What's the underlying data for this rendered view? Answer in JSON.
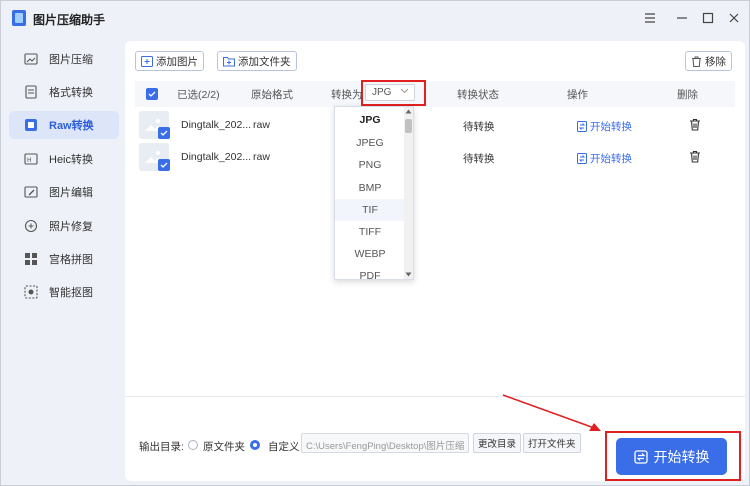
{
  "app": {
    "title": "图片压缩助手"
  },
  "window_controls": {
    "menu": "≡",
    "minimize": "—",
    "maximize": "☐",
    "close": "✕"
  },
  "sidebar": {
    "items": [
      {
        "label": "图片压缩",
        "icon": "image-compress-icon",
        "active": false
      },
      {
        "label": "格式转换",
        "icon": "format-convert-icon",
        "active": false
      },
      {
        "label": "Raw转换",
        "icon": "raw-convert-icon",
        "active": true
      },
      {
        "label": "Heic转换",
        "icon": "heic-convert-icon",
        "active": false
      },
      {
        "label": "图片编辑",
        "icon": "image-edit-icon",
        "active": false
      },
      {
        "label": "照片修复",
        "icon": "photo-repair-icon",
        "active": false
      },
      {
        "label": "宫格拼图",
        "icon": "grid-collage-icon",
        "active": false
      },
      {
        "label": "智能抠图",
        "icon": "smart-cutout-icon",
        "active": false
      }
    ]
  },
  "toolbar": {
    "add_image": "添加图片",
    "add_folder": "添加文件夹",
    "remove": "移除"
  },
  "table": {
    "headers": {
      "selected": "已选(2/2)",
      "original_format": "原始格式",
      "convert_to": "转换为",
      "status": "转换状态",
      "action": "操作",
      "delete": "删除"
    },
    "rows": [
      {
        "name": "Dingtalk_202...",
        "format": "raw",
        "status": "待转换",
        "action": "开始转换"
      },
      {
        "name": "Dingtalk_202...",
        "format": "raw",
        "status": "待转换",
        "action": "开始转换"
      }
    ]
  },
  "format_select": {
    "value": "JPG",
    "options": [
      "JPG",
      "JPEG",
      "PNG",
      "BMP",
      "TIF",
      "TIFF",
      "WEBP",
      "PDF"
    ],
    "hovered": "TIF"
  },
  "output": {
    "label": "输出目录:",
    "option_source": "原文件夹",
    "option_custom": "自定义",
    "path": "C:\\Users\\FengPing\\Desktop\\图片压缩",
    "change_dir": "更改目录",
    "open_folder": "打开文件夹"
  },
  "start_button": {
    "label": "开始转换"
  },
  "colors": {
    "accent": "#3a6ee8",
    "highlight": "#e02020"
  }
}
